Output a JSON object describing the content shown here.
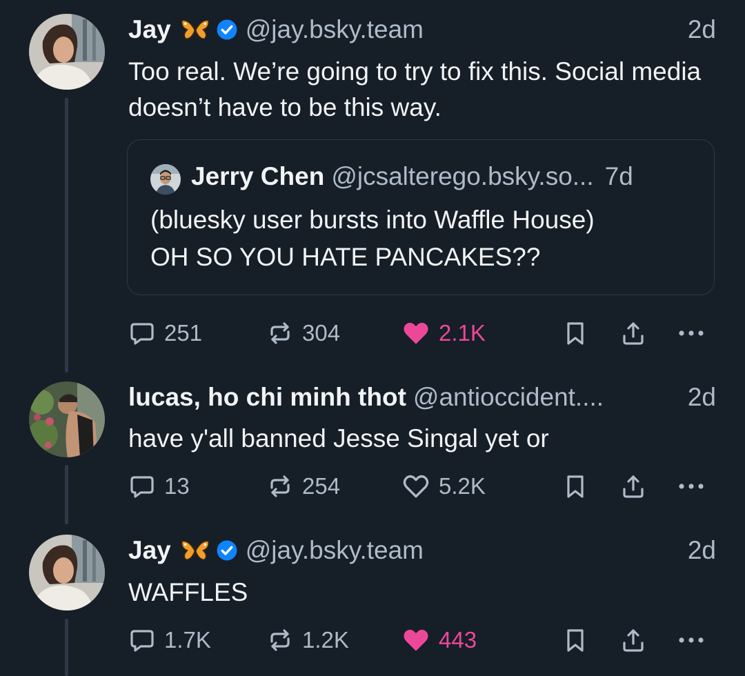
{
  "posts": [
    {
      "author": "Jay",
      "handle": "@jay.bsky.team",
      "time": "2d",
      "text": "Too real. We’re going to try to fix this. Social media doesn’t have to be this way.",
      "quote": {
        "author": "Jerry Chen",
        "handle": "@jcsalterego.bsky.so...",
        "time": "7d",
        "line1": "(bluesky user bursts into Waffle House)",
        "line2": "OH SO YOU HATE PANCAKES??"
      },
      "replies": "251",
      "reposts": "304",
      "likes": "2.1K",
      "liked": true
    },
    {
      "author": "lucas, ho chi minh thot",
      "handle": "@antioccident....",
      "time": "2d",
      "text": "have y'all banned Jesse Singal yet or",
      "replies": "13",
      "reposts": "254",
      "likes": "5.2K",
      "liked": false
    },
    {
      "author": "Jay",
      "handle": "@jay.bsky.team",
      "time": "2d",
      "text": "WAFFLES",
      "replies": "1.7K",
      "reposts": "1.2K",
      "likes": "443",
      "liked": true
    }
  ],
  "icons": {
    "reply": "speech-bubble-icon",
    "repost": "repost-arrows-icon",
    "like": "heart-icon",
    "bookmark": "bookmark-icon",
    "share": "share-icon",
    "more": "more-dots-icon",
    "butterfly": "butterfly-emoji-icon",
    "verified": "verified-check-icon"
  },
  "colors": {
    "background": "#161e27",
    "text": "#f1f3f5",
    "muted": "#aebbc9",
    "like": "#ec4899",
    "verified": "#1083fe",
    "border": "#2e3a47"
  }
}
